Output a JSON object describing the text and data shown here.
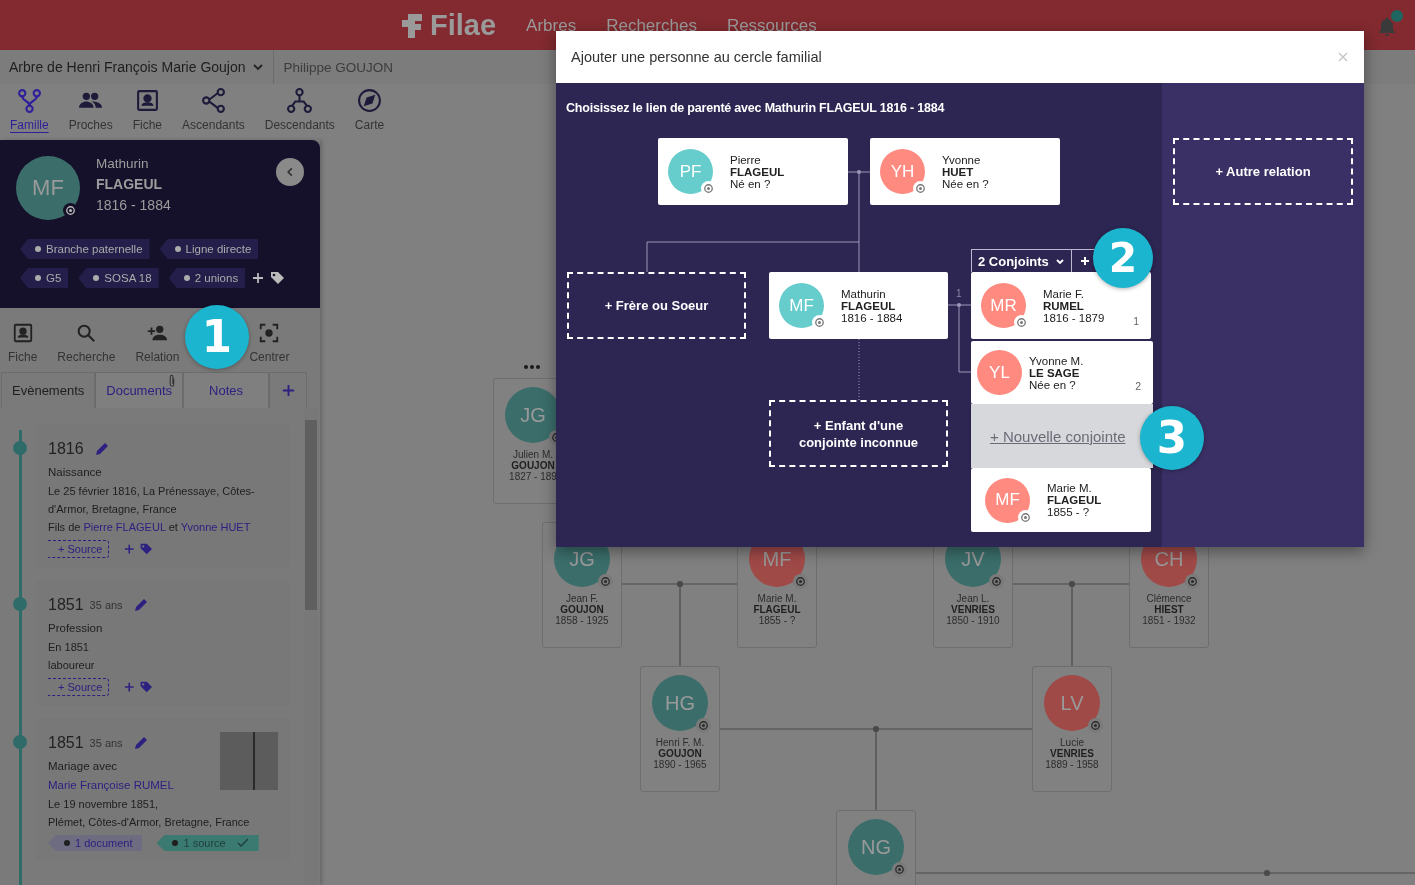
{
  "header": {
    "logo": "Filae",
    "nav": [
      "Arbres",
      "Recherches",
      "Ressources"
    ]
  },
  "subheader": {
    "tree_name": "Arbre de Henri François Marie Goujon",
    "user": "Philippe GOUJON"
  },
  "view_tabs": [
    {
      "kind": "family",
      "label": "Famille",
      "selected": true
    },
    {
      "kind": "relatives",
      "label": "Proches",
      "selected": false
    },
    {
      "kind": "profile",
      "label": "Fiche",
      "selected": false
    },
    {
      "kind": "ancestors",
      "label": "Ascendants",
      "selected": false
    },
    {
      "kind": "descendants",
      "label": "Descendants",
      "selected": false
    },
    {
      "kind": "map",
      "label": "Carte",
      "selected": false
    }
  ],
  "person_panel": {
    "initials": "MF",
    "color": "#3b6e6b",
    "first_name": "Mathurin",
    "last_name": "FLAGEUL",
    "dates": "1816 - 1884",
    "tags": [
      "Branche paternelle",
      "Ligne directe",
      "G5",
      "SOSA 18",
      "2 unions"
    ]
  },
  "panel_toolbar": [
    {
      "kind": "profile",
      "label": "Fiche"
    },
    {
      "kind": "search",
      "label": "Recherche"
    },
    {
      "kind": "add-person",
      "label": "Relation"
    },
    {
      "kind": "covered"
    },
    {
      "kind": "center",
      "label": "Centrer"
    }
  ],
  "panel_tabs": [
    {
      "label": "Evènements",
      "selected": true,
      "attachment": false
    },
    {
      "label": "Documents",
      "selected": false,
      "attachment": true
    },
    {
      "label": "Notes",
      "selected": false,
      "attachment": false
    }
  ],
  "events": [
    {
      "year": "1816",
      "title": [
        {
          "text": "Naissance",
          "link": false
        }
      ],
      "lines": [
        "Le 25 février 1816, La Prénessaye, Côtes-d'Armor, Bretagne, France"
      ],
      "relation": [
        {
          "text": "Fils de ",
          "link": false
        },
        {
          "text": "Pierre FLAGEUL",
          "link": true
        },
        {
          "text": " et ",
          "link": false
        },
        {
          "text": "Yvonne HUET",
          "link": true
        }
      ],
      "source_action": "+ Source",
      "thumbnail": false
    },
    {
      "year": "1851",
      "age": "35 ans",
      "title": [
        {
          "text": "Profession",
          "link": false
        }
      ],
      "lines": [
        "En 1851",
        "laboureur"
      ],
      "source_action": "+ Source",
      "thumbnail": false
    },
    {
      "year": "1851",
      "age": "35 ans",
      "title": [
        {
          "text": "Mariage avec ",
          "link": false
        },
        {
          "text": "Marie Françoise RUMEL",
          "link": true
        }
      ],
      "lines": [
        "Le 19 novembre 1851,",
        "Plémet, Côtes-d'Armor, Bretagne, France"
      ],
      "thumbnail": true,
      "badges": [
        {
          "kind": "document",
          "label": "1 document"
        },
        {
          "kind": "source",
          "label": "1 source"
        }
      ]
    }
  ],
  "tree": [
    {
      "initials": "JG",
      "color": "#3b6e6b",
      "first_name": "Julien M.",
      "last_name": "GOUJON",
      "dates": "1827 - 189"
    },
    {
      "initials": "JG",
      "color": "#3b6e6b",
      "first_name": "Jean F.",
      "last_name": "GOUJON",
      "dates": "1858 - 1925"
    },
    {
      "initials": "MF",
      "color": "#a04a48",
      "first_name": "Marie M.",
      "last_name": "FLAGEUL",
      "dates": "1855 - ?"
    },
    {
      "initials": "JV",
      "color": "#3b6e6b",
      "first_name": "Jean L.",
      "last_name": "VENRIES",
      "dates": "1850 - 1910"
    },
    {
      "initials": "CH",
      "color": "#a04a48",
      "first_name": "Clémence",
      "last_name": "HIEST",
      "dates": "1851 - 1932"
    },
    {
      "initials": "HG",
      "color": "#3b6e6b",
      "first_name": "Henri F. M.",
      "last_name": "GOUJON",
      "dates": "1890 - 1965"
    },
    {
      "initials": "LV",
      "color": "#a04a48",
      "first_name": "Lucie",
      "last_name": "VENRIES",
      "dates": "1889 - 1958"
    },
    {
      "initials": "NG",
      "color": "#3b6e6b"
    }
  ],
  "modal": {
    "title": "Ajouter une personne au cercle familial",
    "subtitle": "Choisissez le lien de parenté avec Mathurin FLAGEUL 1816 - 1884",
    "parents": [
      {
        "initials": "PF",
        "color": "#66cccc",
        "first_name": "Pierre",
        "last_name": "FLAGEUL",
        "dates": "Né en ?"
      },
      {
        "initials": "YH",
        "color": "#ff8a80",
        "first_name": "Yvonne",
        "last_name": "HUET",
        "dates": "Née en ?"
      }
    ],
    "sibling_action": "+ Frère ou Soeur",
    "person": {
      "initials": "MF",
      "color": "#66cccc",
      "first_name": "Mathurin",
      "last_name": "FLAGEUL",
      "dates": "1816 - 1884"
    },
    "union_number": "1",
    "child_action": "+ Enfant d'une conjointe inconnue",
    "spouses_menu": {
      "label": "2 Conjoints",
      "expanded": true
    },
    "spouses": [
      {
        "initials": "MR",
        "color": "#ff8a80",
        "first_name": "Marie F.",
        "last_name": "RUMEL",
        "dates": "1816 - 1879",
        "number": "1"
      },
      {
        "initials": "YL",
        "color": "#ff8a80",
        "first_name": "Yvonne M.",
        "last_name": "LE SAGE",
        "dates": "Née en ?",
        "number": "2"
      }
    ],
    "new_spouse": "+ Nouvelle conjointe",
    "child": {
      "initials": "MF",
      "color": "#ff8a80",
      "first_name": "Marie M.",
      "last_name": "FLAGEUL",
      "dates": "1855 - ?"
    },
    "other_relation": "+ Autre relation"
  },
  "callouts": [
    "1",
    "2",
    "3"
  ]
}
